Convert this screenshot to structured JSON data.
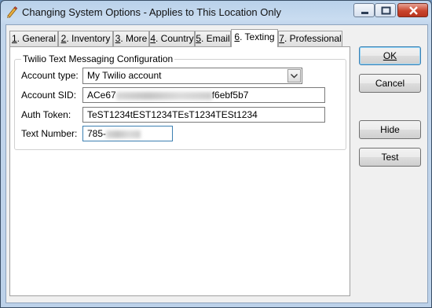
{
  "window": {
    "title": "Changing System Options - Applies to This Location Only"
  },
  "tabs": [
    {
      "key": "1",
      "rest": ". General"
    },
    {
      "key": "2",
      "rest": ". Inventory"
    },
    {
      "key": "3",
      "rest": ". More"
    },
    {
      "key": "4",
      "rest": ". Country"
    },
    {
      "key": "5",
      "rest": ". Email"
    },
    {
      "key": "6",
      "rest": ". Texting"
    },
    {
      "key": "7",
      "rest": ". Professional"
    }
  ],
  "group": {
    "title": "Twilio Text Messaging Configuration"
  },
  "form": {
    "account_type_label": "Account type:",
    "account_type_value": "My Twilio account",
    "account_sid_label": "Account SID:",
    "account_sid_prefix": "ACe67",
    "account_sid_suffix": "f6ebf5b7",
    "auth_token_label": "Auth Token:",
    "auth_token_value": "TeST1234tEST1234TEsT1234TESt1234",
    "text_number_label": "Text Number:",
    "text_number_prefix": "785-"
  },
  "buttons": {
    "ok": "OK",
    "cancel": "Cancel",
    "hide": "Hide",
    "test": "Test"
  }
}
